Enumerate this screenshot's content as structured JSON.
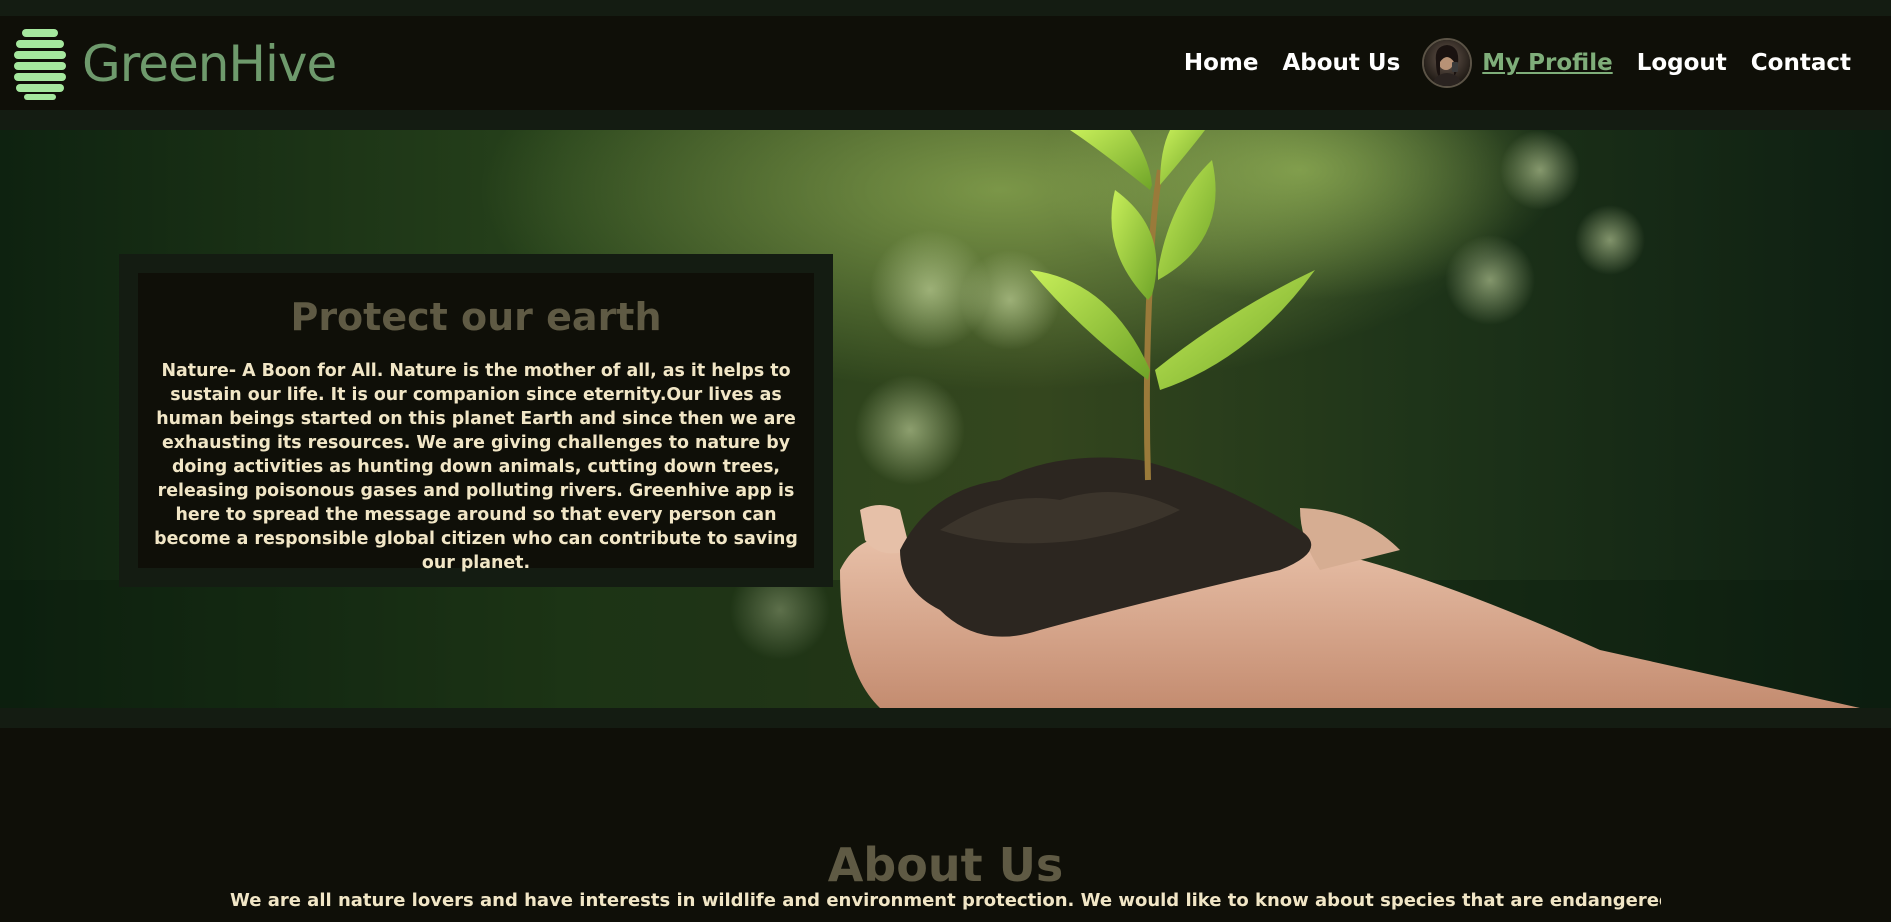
{
  "brand": {
    "name": "GreenHive"
  },
  "nav": {
    "home": "Home",
    "about": "About Us",
    "profile": "My Profile",
    "logout": "Logout",
    "contact": "Contact"
  },
  "hero": {
    "title": "Protect our earth",
    "text": "Nature- A Boon for All. Nature is the mother of all, as it helps to sustain our life. It is our companion since eternity.Our lives as human beings started on this planet Earth and since then we are exhausting its resources. We are giving challenges to nature by doing activities as hunting down animals, cutting down trees, releasing poisonous gases and polluting rivers. Greenhive app is here to spread the message around so that every person can become a responsible global citizen who can contribute to saving our planet."
  },
  "about": {
    "title": "About Us",
    "text": "We are all nature lovers and have interests in wildlife and environment protection. We would like to know about species that are endangered and the"
  },
  "colors": {
    "background": "#0f0f08",
    "strip": "#141c12",
    "brand": "#6e9a6c",
    "logo_icon": "#a5e89e",
    "profile_link": "#7fae7a",
    "heading": "#5f5a44",
    "body_text": "#f1e6c6"
  }
}
